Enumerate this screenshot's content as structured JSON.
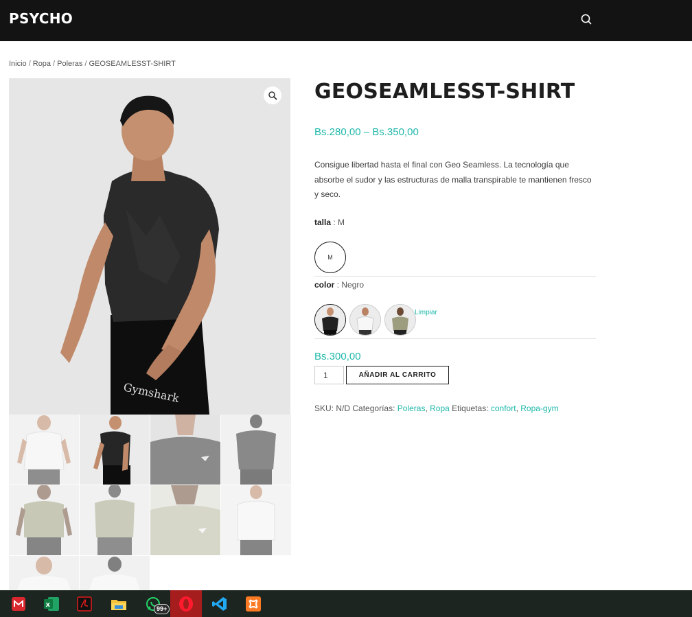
{
  "header": {
    "logo": "PSYCHO",
    "search_icon": "search-icon"
  },
  "breadcrumb": {
    "items": [
      "Inicio",
      "Ropa",
      "Poleras"
    ],
    "current": "GEOSEAMLESST-SHIRT",
    "separator": "/"
  },
  "product": {
    "title": "GEOSEAMLESST-SHIRT",
    "price_range": "Bs.280,00 – Bs.350,00",
    "description": "Consigue libertad hasta el final con Geo Seamless. La tecnología que absorbe el sudor y las estructuras de malla transpirable te mantienen fresco y seco.",
    "price": "Bs.300,00",
    "quantity": "1",
    "add_to_cart": "AÑADIR AL CARRITO"
  },
  "attributes": {
    "talla": {
      "label": "talla",
      "separator": " : ",
      "value": "M",
      "options": [
        "M"
      ]
    },
    "color": {
      "label": "color",
      "separator": " : ",
      "value": "Negro",
      "options": [
        "Negro",
        "Blanco",
        "Verde"
      ]
    },
    "clear": "Limpiar"
  },
  "meta": {
    "sku_label": "SKU:",
    "sku_value": "N/D",
    "categories_label": "Categorías:",
    "categories": [
      "Poleras",
      "Ropa"
    ],
    "tags_label": "Etiquetas:",
    "tags": [
      "confort",
      "Ropa-gym"
    ],
    "comma": ", "
  },
  "taskbar": {
    "apps": [
      "mega-icon",
      "excel-icon",
      "acrobat-icon",
      "file-explorer-icon",
      "whatsapp-icon",
      "opera-icon",
      "vscode-icon",
      "xampp-icon"
    ],
    "whatsapp_badge": "99+",
    "active": "opera-icon"
  },
  "colors": {
    "accent": "#1fb8aa",
    "header_bg": "#131313",
    "text_dark": "#1e1e1e",
    "taskbar_bg": "#1c2520"
  }
}
